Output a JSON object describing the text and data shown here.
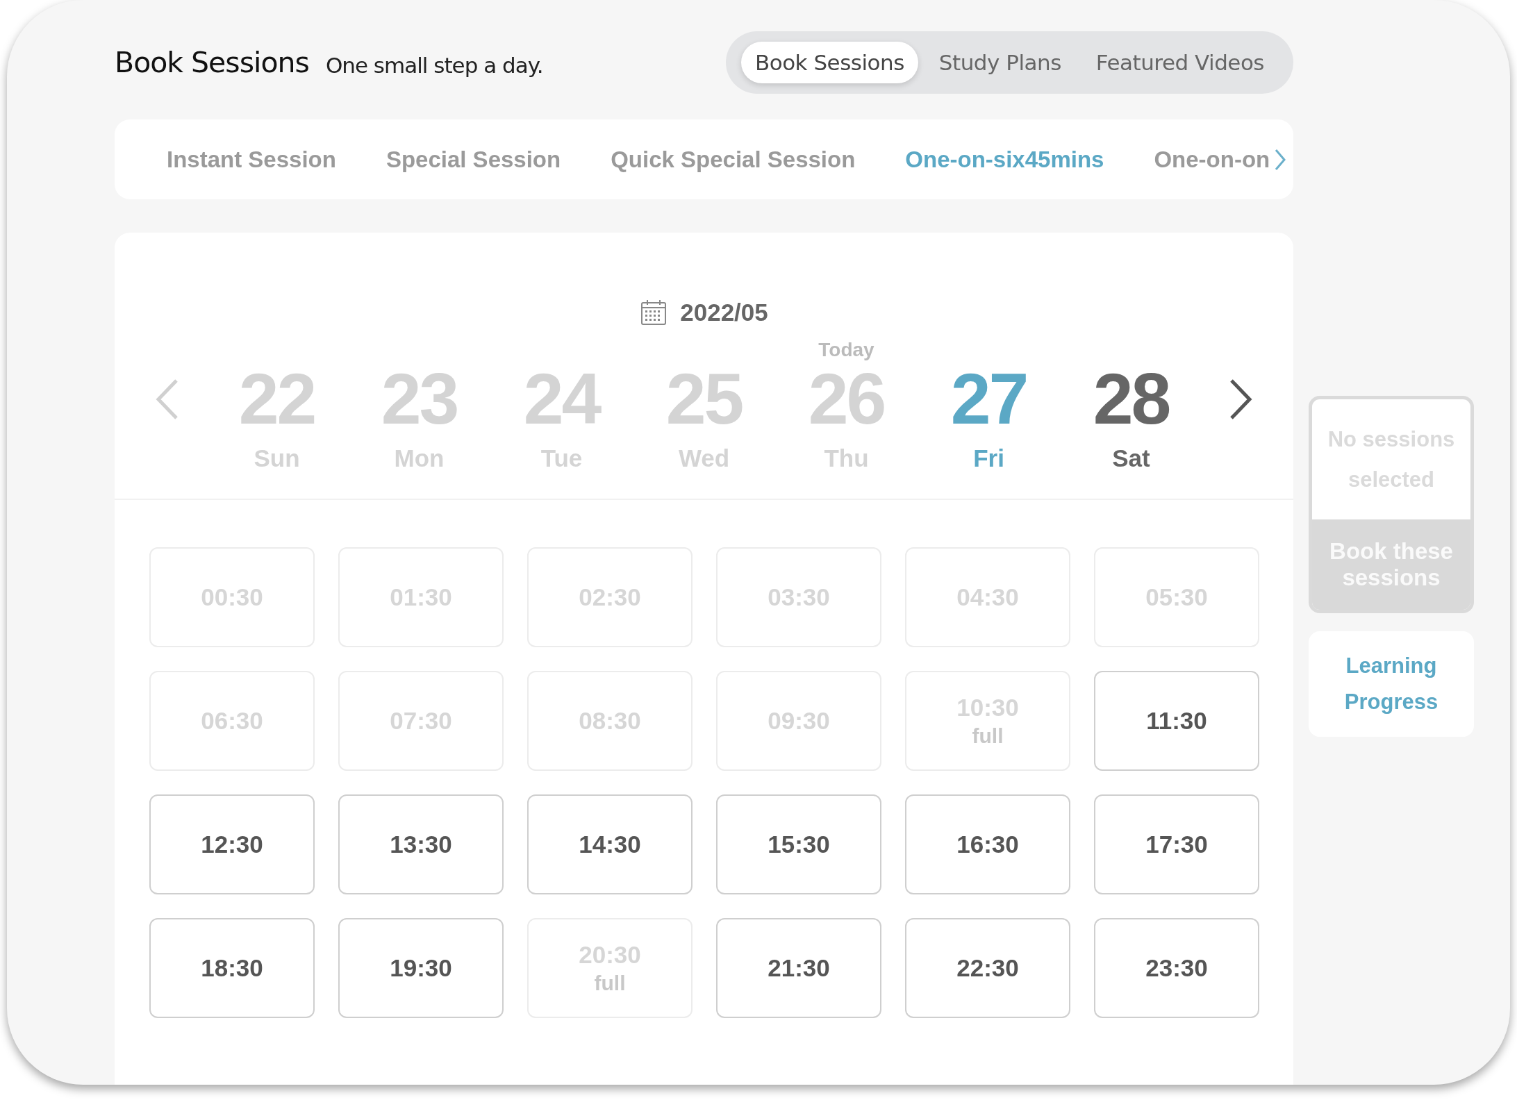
{
  "header": {
    "title": "Book Sessions",
    "subtitle": "One small step a day."
  },
  "top_tabs": [
    {
      "label": "Book Sessions",
      "selected": true
    },
    {
      "label": "Study Plans",
      "selected": false
    },
    {
      "label": "Featured Videos",
      "selected": false
    }
  ],
  "session_tabs": [
    {
      "label": "Instant Session",
      "selected": false
    },
    {
      "label": "Special Session",
      "selected": false
    },
    {
      "label": "Quick Special Session",
      "selected": false
    },
    {
      "label": "One-on-six45mins",
      "selected": true
    },
    {
      "label": "One-on-on",
      "selected": false
    }
  ],
  "calendar": {
    "month": "2022/05",
    "days": [
      {
        "number": "22",
        "weekday": "Sun",
        "available": false,
        "selected": false
      },
      {
        "number": "23",
        "weekday": "Mon",
        "available": false,
        "selected": false
      },
      {
        "number": "24",
        "weekday": "Tue",
        "available": false,
        "selected": false
      },
      {
        "number": "25",
        "weekday": "Wed",
        "available": false,
        "selected": false
      },
      {
        "number": "26",
        "weekday": "Thu",
        "note": "Today",
        "available": false,
        "selected": false
      },
      {
        "number": "27",
        "weekday": "Fri",
        "available": true,
        "selected": true
      },
      {
        "number": "28",
        "weekday": "Sat",
        "available": true,
        "selected": false
      }
    ]
  },
  "slots": [
    {
      "time": "00:30",
      "available": false
    },
    {
      "time": "01:30",
      "available": false
    },
    {
      "time": "02:30",
      "available": false
    },
    {
      "time": "03:30",
      "available": false
    },
    {
      "time": "04:30",
      "available": false
    },
    {
      "time": "05:30",
      "available": false
    },
    {
      "time": "06:30",
      "available": false
    },
    {
      "time": "07:30",
      "available": false
    },
    {
      "time": "08:30",
      "available": false
    },
    {
      "time": "09:30",
      "available": false
    },
    {
      "time": "10:30",
      "note": "full",
      "available": false
    },
    {
      "time": "11:30",
      "available": true
    },
    {
      "time": "12:30",
      "available": true
    },
    {
      "time": "13:30",
      "available": true
    },
    {
      "time": "14:30",
      "available": true
    },
    {
      "time": "15:30",
      "available": true
    },
    {
      "time": "16:30",
      "available": true
    },
    {
      "time": "17:30",
      "available": true
    },
    {
      "time": "18:30",
      "available": true
    },
    {
      "time": "19:30",
      "available": true
    },
    {
      "time": "20:30",
      "note": "full",
      "available": false
    },
    {
      "time": "21:30",
      "available": true
    },
    {
      "time": "22:30",
      "available": true
    },
    {
      "time": "23:30",
      "available": true
    }
  ],
  "booking": {
    "status": "No sessions selected",
    "button": "Book these sessions",
    "disabled": true
  },
  "learning_link": "Learning Progress"
}
